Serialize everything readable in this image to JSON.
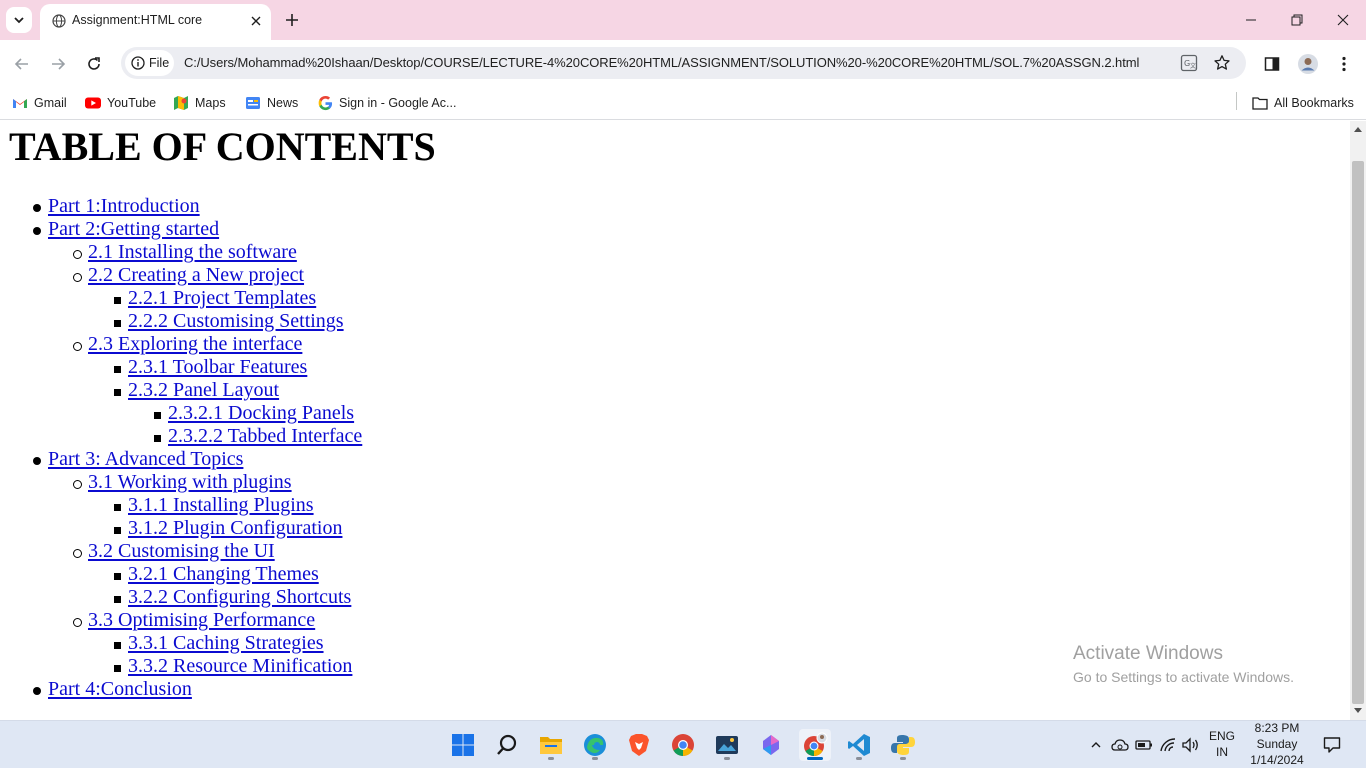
{
  "browser": {
    "tab": {
      "title": "Assignment:HTML core",
      "favicon": "globe-icon"
    },
    "url_chip": "File",
    "url": "C:/Users/Mohammad%20Ishaan/Desktop/COURSE/LECTURE-4%20CORE%20HTML/ASSIGNMENT/SOLUTION%20-%20CORE%20HTML/SOL.7%20ASSGN.2.html",
    "bookmarks": [
      {
        "label": "Gmail",
        "icon": "gmail-icon"
      },
      {
        "label": "YouTube",
        "icon": "youtube-icon"
      },
      {
        "label": "Maps",
        "icon": "maps-icon"
      },
      {
        "label": "News",
        "icon": "news-icon"
      },
      {
        "label": "Sign in - Google Ac...",
        "icon": "google-icon"
      }
    ],
    "all_bookmarks": "All Bookmarks"
  },
  "page": {
    "title": "TABLE OF CONTENTS",
    "toc": [
      {
        "text": "Part 1:Introduction",
        "level": 1
      },
      {
        "text": "Part 2:Getting started",
        "level": 1
      },
      {
        "text": "2.1 Installing the software",
        "level": 2
      },
      {
        "text": "2.2 Creating a New project",
        "level": 2
      },
      {
        "text": "2.2.1 Project Templates",
        "level": 3
      },
      {
        "text": "2.2.2 Customising Settings",
        "level": 3
      },
      {
        "text": "2.3 Exploring the interface",
        "level": 2
      },
      {
        "text": "2.3.1 Toolbar Features",
        "level": 3
      },
      {
        "text": "2.3.2 Panel Layout",
        "level": 3
      },
      {
        "text": "2.3.2.1 Docking Panels",
        "level": 4
      },
      {
        "text": "2.3.2.2 Tabbed Interface",
        "level": 4
      },
      {
        "text": "Part 3: Advanced Topics",
        "level": 1
      },
      {
        "text": "3.1 Working with plugins",
        "level": 2
      },
      {
        "text": "3.1.1 Installing Plugins",
        "level": 3
      },
      {
        "text": "3.1.2 Plugin Configuration",
        "level": 3
      },
      {
        "text": "3.2 Customising the UI",
        "level": 2
      },
      {
        "text": "3.2.1 Changing Themes",
        "level": 3
      },
      {
        "text": "3.2.2 Configuring Shortcuts",
        "level": 3
      },
      {
        "text": "3.3 Optimising Performance",
        "level": 2
      },
      {
        "text": "3.3.1 Caching Strategies",
        "level": 3
      },
      {
        "text": "3.3.2 Resource Minification",
        "level": 3
      },
      {
        "text": "Part 4:Conclusion",
        "level": 1
      }
    ]
  },
  "watermark": {
    "line1": "Activate Windows",
    "line2": "Go to Settings to activate Windows."
  },
  "taskbar": {
    "apps": [
      "windows-start-icon",
      "search-icon",
      "file-explorer-icon",
      "edge-icon",
      "brave-icon",
      "chrome-icon",
      "photo-app-icon",
      "copilot-icon",
      "chrome-profile-icon",
      "vscode-icon",
      "python-icon"
    ],
    "language": "ENG",
    "region": "IN",
    "time": "8:23 PM",
    "day": "Sunday",
    "date": "1/14/2024"
  },
  "colors": {
    "tab_strip": "#f6d6e4",
    "link": "#0b0bd0",
    "taskbar": "#dfe7f4"
  }
}
